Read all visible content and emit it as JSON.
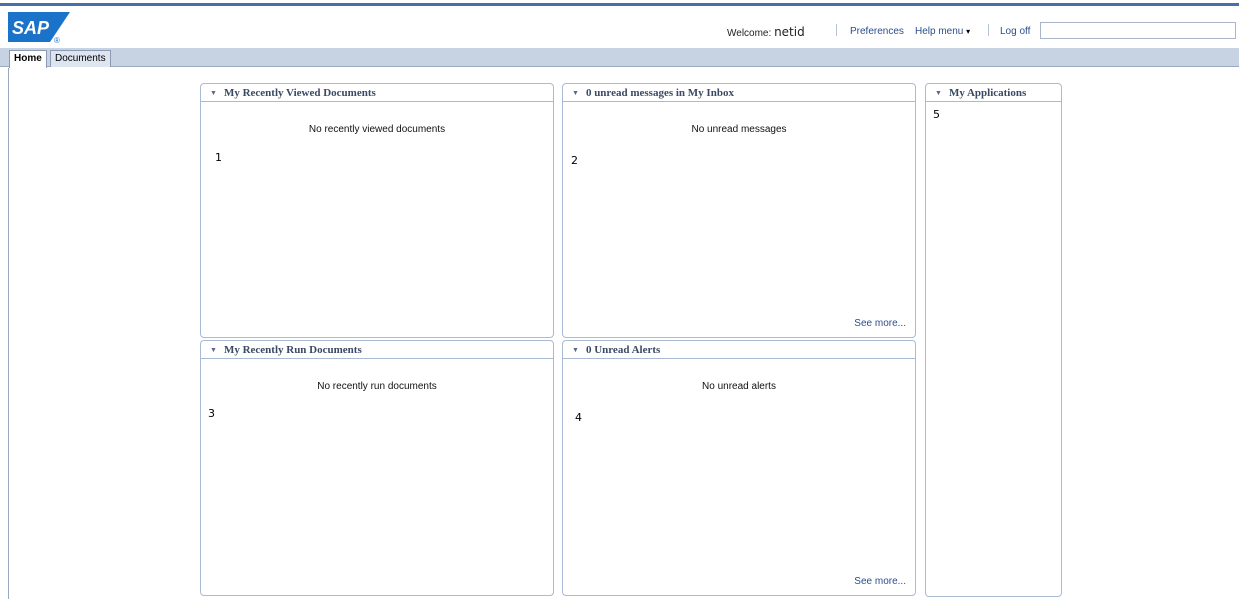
{
  "brand": {
    "logo_text": "SAP",
    "logo_mark": "®",
    "colors": {
      "logo_blue": "#1a73c8",
      "top_line": "#4a6ea9",
      "link": "#2b4e8c",
      "tabbar": "#c7d2e3"
    }
  },
  "header": {
    "welcome_label": "Welcome:",
    "user_id": "netid",
    "preferences": "Preferences",
    "help_menu": "Help menu",
    "help_caret": "▾",
    "log_off": "Log off",
    "search_value": ""
  },
  "tabs": [
    {
      "label": "Home",
      "active": true
    },
    {
      "label": "Documents",
      "active": false
    }
  ],
  "panels": {
    "recently_viewed": {
      "title": "My Recently Viewed Documents",
      "message": "No recently viewed documents",
      "marker": "1"
    },
    "inbox": {
      "title": "0 unread messages in My Inbox",
      "message": "No unread messages",
      "marker": "2",
      "see_more": "See more..."
    },
    "recently_run": {
      "title": "My Recently Run Documents",
      "message": "No recently run documents",
      "marker": "3"
    },
    "alerts": {
      "title": "0 Unread Alerts",
      "message": "No unread alerts",
      "marker": "4",
      "see_more": "See more..."
    },
    "applications": {
      "title": "My Applications",
      "marker": "5"
    }
  },
  "icons": {
    "collapse": "triangle-down-icon",
    "caret": "caret-down-icon"
  }
}
